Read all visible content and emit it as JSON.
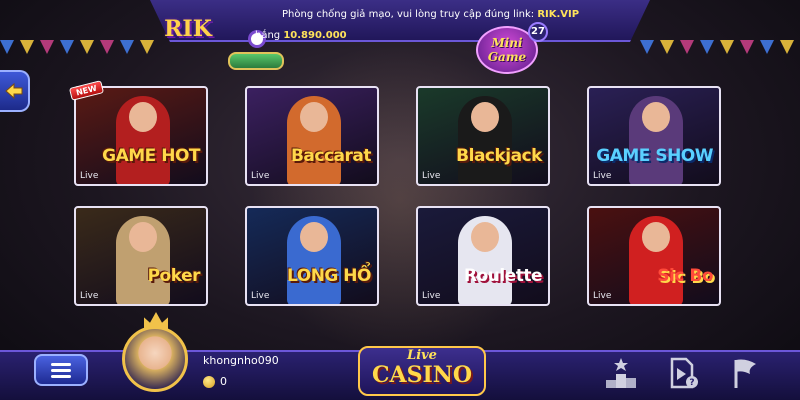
{
  "header": {
    "notice_text": "Phòng chống giả mạo, vui lòng truy cập đúng link: ",
    "notice_link": "RIK.VIP",
    "jackpot_label": "hắng",
    "jackpot_value": "10.890.000",
    "logo_text": "RIK",
    "mini_game_label_1": "Mini",
    "mini_game_label_2": "Game",
    "mini_game_count": "27"
  },
  "games": [
    {
      "name": "GAME HOT",
      "live": "Live",
      "new_badge": "NEW",
      "bg": "#5a1a14",
      "dealer": "#b31f1f"
    },
    {
      "name": "Baccarat",
      "live": "Live",
      "bg": "#3b2060",
      "dealer": "#d26a2d"
    },
    {
      "name": "Blackjack",
      "live": "Live",
      "bg": "#1a3a2a",
      "dealer": "#1a1a1a"
    },
    {
      "name": "GAME SHOW",
      "live": "Live",
      "bg": "#2a2055",
      "dealer": "#5a3a7a"
    },
    {
      "name": "Poker",
      "live": "Live",
      "bg": "#3a2a1a",
      "dealer": "#c0a070"
    },
    {
      "name": "LONG HỔ",
      "live": "Live",
      "bg": "#152a58",
      "dealer": "#3a6ad0"
    },
    {
      "name": "Roulette",
      "live": "Live",
      "bg": "#1a1a3a",
      "dealer": "#e6e6f0"
    },
    {
      "name": "Sic Bo",
      "live": "Live",
      "bg": "#4a1010",
      "dealer": "#d02020"
    }
  ],
  "user": {
    "username": "khongnho090",
    "balance": "0"
  },
  "footer": {
    "casino_live": "Live",
    "casino_main": "CASINO"
  },
  "colors": {
    "accent_gold": "#ffd84a",
    "bar_purple": "#2a2170",
    "button_blue": "#3e59d8"
  },
  "icons": [
    "back-arrow-icon",
    "menu-icon",
    "leaderboard-icon",
    "history-icon",
    "guide-icon"
  ]
}
